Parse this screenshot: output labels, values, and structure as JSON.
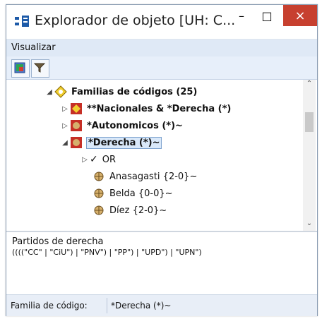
{
  "window": {
    "title": "Explorador de objeto [UH: C...",
    "controls": {
      "minimize": "–",
      "maximize": "□",
      "close": "×"
    }
  },
  "menu": {
    "items": [
      "Visualizar"
    ]
  },
  "toolbar": {
    "buttons": [
      {
        "name": "network-view-icon"
      },
      {
        "name": "filter-icon"
      }
    ]
  },
  "tree": {
    "items": [
      {
        "label": "Familias de códigos (25)",
        "bold": true,
        "expander": "◢"
      },
      {
        "label": "**Nacionales & *Derecha (*)",
        "bold": true,
        "expander": "▷"
      },
      {
        "label": "*Autonomicos (*)~",
        "bold": true,
        "expander": "▷"
      },
      {
        "label": "*Derecha (*)~",
        "bold": true,
        "expander": "◢"
      },
      {
        "label": "OR",
        "bold": false,
        "expander": "▷"
      },
      {
        "label": "Anasagasti {2-0}~",
        "bold": false,
        "expander": ""
      },
      {
        "label": "Belda {0-0}~",
        "bold": false,
        "expander": ""
      },
      {
        "label": "Díez {2-0}~",
        "bold": false,
        "expander": ""
      }
    ],
    "scrollbar": {
      "up": "⌃",
      "down": "⌄"
    }
  },
  "description": {
    "title": "Partidos de derecha",
    "query": "((((\"CC\" | \"CiU\") | \"PNV\") | \"PP\") | \"UPD\") | \"UPN\")"
  },
  "status": {
    "label": "Familia de código:",
    "value": "*Derecha (*)~"
  },
  "colors": {
    "accent": "#c7402f",
    "menu_bg": "#dfe9f6",
    "toolbar_bg": "#e7effa"
  }
}
